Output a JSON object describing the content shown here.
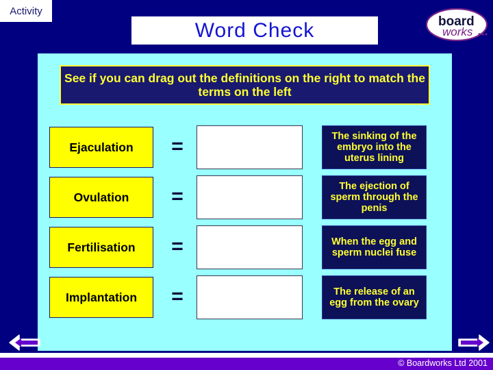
{
  "header": {
    "activity_tab_label": "Activity",
    "title": "Word Check",
    "logo": {
      "name": "boardworks-logo",
      "word1": "board",
      "word2": "works"
    }
  },
  "main": {
    "instruction": "See if you can drag out the definitions on the right to match the terms on the left",
    "equals_symbol": "=",
    "rows": [
      {
        "term": "Ejaculation",
        "drop_value": "",
        "definition": "The sinking of the embryo into the uterus lining"
      },
      {
        "term": "Ovulation",
        "drop_value": "",
        "definition": "The ejection of sperm through the penis"
      },
      {
        "term": "Fertilisation",
        "drop_value": "",
        "definition": "When the egg and sperm nuclei fuse"
      },
      {
        "term": "Implantation",
        "drop_value": "",
        "definition": "The release of an egg from the ovary"
      }
    ]
  },
  "navigation": {
    "prev_icon": "left-arrow-icon",
    "next_icon": "right-arrow-icon"
  },
  "footer": {
    "copyright": "© Boardworks Ltd 2001"
  },
  "colors": {
    "background_navy": "#000080",
    "panel_cyan": "#99ffff",
    "term_yellow": "#ffff00",
    "definition_navy": "#0d1157",
    "text_yellow": "#ffff33",
    "title_blue": "#1414d2",
    "footer_purple": "#6600cc",
    "arrow_purple": "#6600cc"
  }
}
